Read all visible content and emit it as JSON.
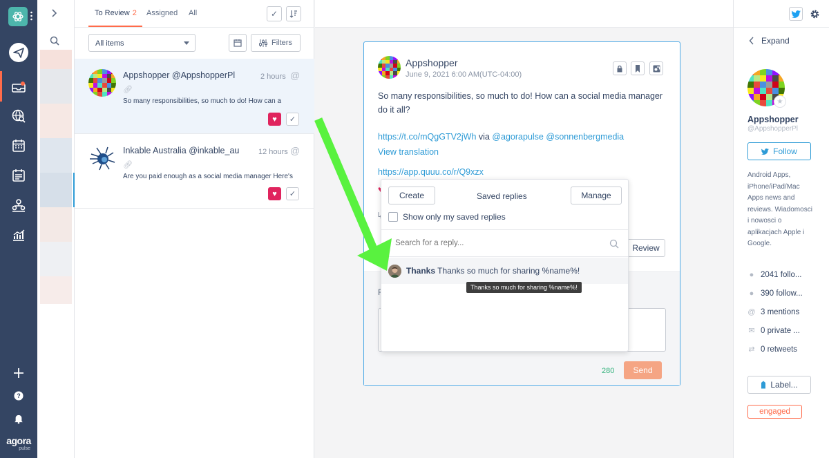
{
  "tabs": {
    "to_review": "To Review",
    "to_review_count": "2",
    "assigned": "Assigned",
    "all": "All"
  },
  "filters": {
    "items_select": "All items",
    "filters_label": "Filters"
  },
  "items": [
    {
      "name": "Appshopper @AppshopperPl",
      "time": "2 hours",
      "text": "So many responsibilities, so much to do! How can a"
    },
    {
      "name": "Inkable Australia @inkable_au",
      "time": "12 hours",
      "text": "Are you paid enough as a social media manager Here's"
    }
  ],
  "post": {
    "author": "Appshopper",
    "date": "June 9, 2021 6:00 AM(UTC-04:00)",
    "text": "So many responsibilities, so much to do! How can a social media manager do it all?",
    "link1": "https://t.co/mQgGTV2jWh",
    "via": " via ",
    "mention1": "@agorapulse",
    "mention2": "@sonnenbergmedia",
    "view_translation": "View translation",
    "link2": "https://app.quuu.co/r/Q9xzx",
    "review_label": "Review",
    "char_count": "280",
    "send_label": "Send"
  },
  "saved_replies": {
    "create_label": "Create",
    "title": "Saved replies",
    "manage_label": "Manage",
    "checkbox_label": "Show only my saved replies",
    "search_placeholder": "Search for a reply...",
    "reply_title": "Thanks",
    "reply_text": "Thanks so much for sharing %name%!",
    "tooltip": "Thanks so much for sharing %name%!"
  },
  "profile": {
    "expand_label": "Expand",
    "name": "Appshopper",
    "handle": "@AppshopperPl",
    "follow_label": "Follow",
    "bio": "Android Apps, iPhone/iPad/Mac Apps news and reviews. Wiadomosci i nowosci o aplikacjach Apple i Google.",
    "stats": [
      "2041 follo...",
      "390 follow...",
      "3 mentions",
      "0 private ...",
      "0 retweets"
    ],
    "label_btn": "Label...",
    "tag": "engaged"
  },
  "brand": {
    "name": "agora",
    "sub": "pulse"
  },
  "colors": {
    "nav_bg": "#344563",
    "accent": "#ff6b4a",
    "link": "#2e9bd6",
    "twitter": "#1da1f2",
    "heart": "#e0245e",
    "arrow": "#59f23f"
  },
  "icons": {
    "nav": [
      "brand-logo-icon",
      "send-icon",
      "inbox-icon",
      "globe-search-icon",
      "calendar-icon",
      "calendar-list-icon",
      "team-icon",
      "reports-icon",
      "add-icon",
      "help-icon",
      "bell-icon"
    ]
  }
}
